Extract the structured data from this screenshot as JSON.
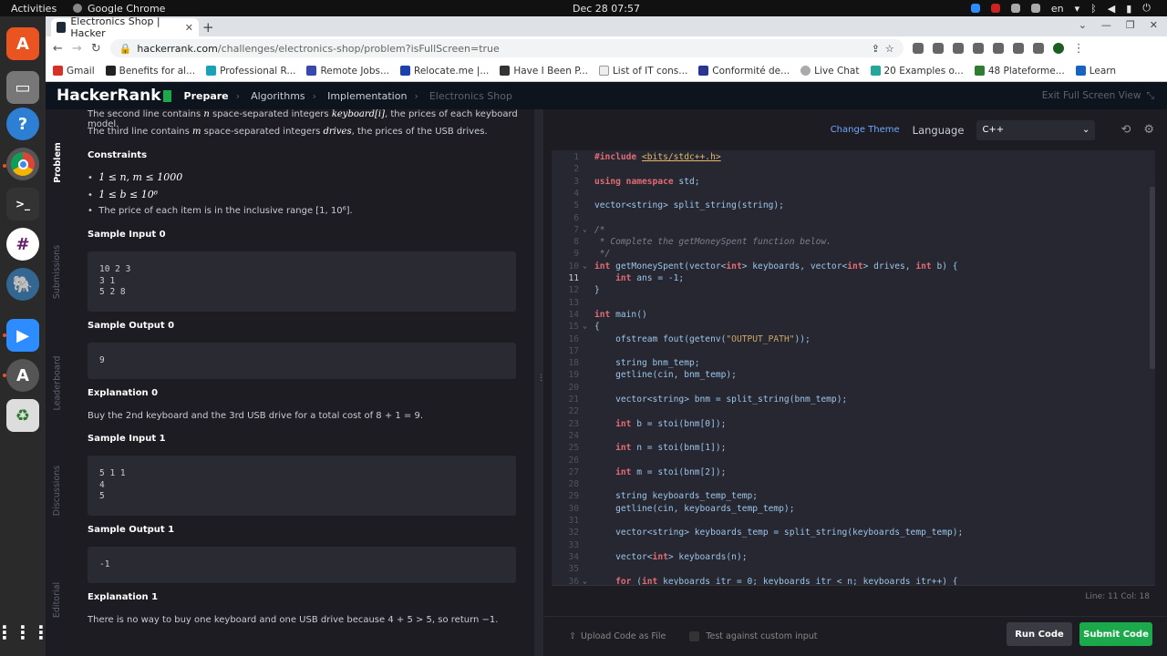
{
  "os": {
    "activities": "Activities",
    "app_name": "Google Chrome",
    "clock": "Dec 28  07:57",
    "keyboard_layout": "en"
  },
  "browser": {
    "tab_title": "Electronics Shop | Hacker",
    "url_host": "hackerrank.com",
    "url_path": "/challenges/electronics-shop/problem?isFullScreen=true",
    "bookmarks": [
      "Gmail",
      "Benefits for al...",
      "Professional R...",
      "Remote Jobs...",
      "Relocate.me |...",
      "Have I Been P...",
      "List of IT cons...",
      "Conformité de...",
      "Live Chat",
      "20 Examples o...",
      "48 Plateforme...",
      "Learn"
    ]
  },
  "header": {
    "logo": "HackerRank",
    "crumbs": [
      "Prepare",
      "Algorithms",
      "Implementation",
      "Electronics Shop"
    ],
    "exit_fullscreen": "Exit Full Screen View"
  },
  "side_tabs": [
    "Problem",
    "Submissions",
    "Leaderboard",
    "Discussions",
    "Editorial"
  ],
  "problem": {
    "line2_pre": "The second line contains ",
    "line2_n": "n",
    "line2_mid": " space-separated integers ",
    "line2_var": "keyboard[i]",
    "line2_post": ", the prices of each keyboard model.",
    "line3_pre": "The third line contains ",
    "line3_m": "m",
    "line3_mid": " space-separated integers ",
    "line3_var": "drives",
    "line3_post": ", the prices of the USB drives.",
    "constraints_title": "Constraints",
    "constraints": [
      "1 ≤ n, m ≤ 1000",
      "1 ≤ b ≤ 10⁶",
      "The price of each item is in the inclusive range [1, 10⁶]."
    ],
    "sample_input_0_title": "Sample Input 0",
    "sample_input_0": [
      "10 2 3",
      "3 1",
      "5 2 8"
    ],
    "sample_output_0_title": "Sample Output 0",
    "sample_output_0": "9",
    "explanation_0_title": "Explanation 0",
    "explanation_0": "Buy the 2nd keyboard and the 3rd USB drive for a total cost of 8 + 1 = 9.",
    "sample_input_1_title": "Sample Input 1",
    "sample_input_1": [
      "5 1 1",
      "4",
      "5"
    ],
    "sample_output_1_title": "Sample Output 1",
    "sample_output_1": "-1",
    "explanation_1_title": "Explanation 1",
    "explanation_1": "There is no way to buy one keyboard and one USB drive because 4 + 5 > 5, so return −1."
  },
  "editor": {
    "change_theme": "Change Theme",
    "language_label": "Language",
    "language_value": "C++",
    "cursor_status": "Line: 11  Col: 18",
    "upload": "Upload Code as File",
    "custom_input": "Test against custom input",
    "run": "Run Code",
    "submit": "Submit Code",
    "active_line": 11,
    "lines": [
      "#include <bits/stdc++.h>",
      "",
      "using namespace std;",
      "",
      "vector<string> split_string(string);",
      "",
      "/*",
      " * Complete the getMoneySpent function below.",
      " */",
      "int getMoneySpent(vector<int> keyboards, vector<int> drives, int b) {",
      "    int ans = -1;",
      "}",
      "",
      "int main()",
      "{",
      "    ofstream fout(getenv(\"OUTPUT_PATH\"));",
      "",
      "    string bnm_temp;",
      "    getline(cin, bnm_temp);",
      "",
      "    vector<string> bnm = split_string(bnm_temp);",
      "",
      "    int b = stoi(bnm[0]);",
      "",
      "    int n = stoi(bnm[1]);",
      "",
      "    int m = stoi(bnm[2]);",
      "",
      "    string keyboards_temp_temp;",
      "    getline(cin, keyboards_temp_temp);",
      "",
      "    vector<string> keyboards_temp = split_string(keyboards_temp_temp);",
      "",
      "    vector<int> keyboards(n);",
      "",
      "    for (int keyboards_itr = 0; keyboards_itr < n; keyboards_itr++) {"
    ],
    "fold_lines": [
      7,
      10,
      15,
      36
    ]
  }
}
